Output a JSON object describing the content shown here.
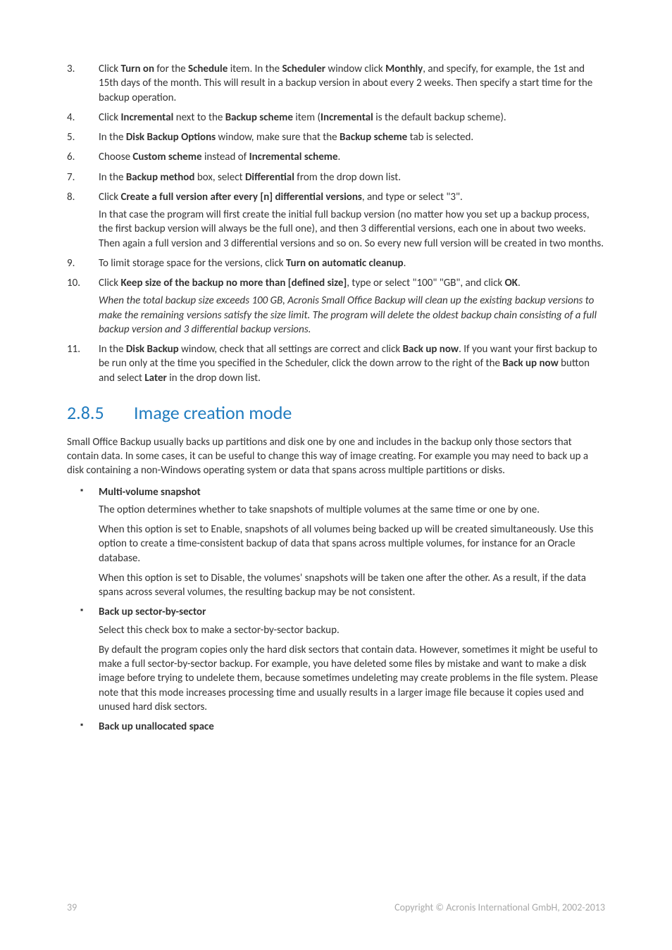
{
  "list": {
    "i3": {
      "num": "3.",
      "html": "Click <b>Turn on</b> for the <b>Schedule</b> item. In the <b>Scheduler</b> window click <b>Monthly</b>, and specify, for example, the 1st and 15th days of the month. This will result in a backup version in about every 2 weeks. Then specify a start time for the backup operation."
    },
    "i4": {
      "num": "4.",
      "html": "Click <b>Incremental</b> next to the <b>Backup scheme</b> item (<b>Incremental</b> is the default backup scheme)."
    },
    "i5": {
      "num": "5.",
      "html": "In the <b>Disk Backup Options</b> window, make sure that the <b>Backup scheme</b> tab is selected."
    },
    "i6": {
      "num": "6.",
      "html": "Choose <b>Custom scheme</b> instead of <b>Incremental scheme</b>."
    },
    "i7": {
      "num": "7.",
      "html": "In the <b>Backup method</b> box, select <b>Differential</b> from the drop down list."
    },
    "i8": {
      "num": "8.",
      "html": "Click <b>Create a full version after every [n] differential versions</b>, and type or select \"3\".",
      "sub": "In that case the program will first create the initial full backup version (no matter how you set up a backup process, the first backup version will always be the full one), and then 3 differential versions, each one in about two weeks. Then again a full version and 3 differential versions and so on. So every new full version will be created in two months."
    },
    "i9": {
      "num": "9.",
      "html": "To limit storage space for the versions, click <b>Turn on automatic cleanup</b>."
    },
    "i10": {
      "num": "10.",
      "html": "Click <b>Keep size of the backup no more than [defined size]</b>, type or select \"100\" \"GB\", and click <b>OK</b>.",
      "note": "When the total backup size exceeds 100 GB, Acronis Small Office Backup will clean up the existing backup versions to make the remaining versions satisfy the size limit. The program will delete the oldest backup chain consisting of a full backup version and 3 differential backup versions."
    },
    "i11": {
      "num": "11.",
      "html": "In the <b>Disk Backup</b> window, check that all settings are correct and click <b>Back up now</b>. If you want your first backup to be run only at the time you specified in the Scheduler, click the down arrow to the right of the <b>Back up now</b> button and select <b>Later</b> in the drop down list."
    }
  },
  "section": {
    "num": "2.8.5",
    "title": "Image creation mode"
  },
  "intro": "Small Office Backup usually backs up partitions and disk one by one and includes in the backup only those sectors that contain data. In some cases, it can be useful to change this way of image creating. For example you may need to back up a disk containing a non-Windows operating system or data that spans across multiple partitions or disks.",
  "bullets": {
    "b1": {
      "title": "Multi-volume snapshot",
      "p1": "The option determines whether to take snapshots of multiple volumes at the same time or one by one.",
      "p2": "When this option is set to Enable, snapshots of all volumes being backed up will be created simultaneously. Use this option to create a time-consistent backup of data that spans across multiple volumes, for instance for an Oracle database.",
      "p3": "When this option is set to Disable, the volumes' snapshots will be taken one after the other. As a result, if the data spans across several volumes, the resulting backup may be not consistent."
    },
    "b2": {
      "title": "Back up sector-by-sector",
      "p1": "Select this check box to make a sector-by-sector backup.",
      "p2": "By default the program copies only the hard disk sectors that contain data. However, sometimes it might be useful to make a full sector-by-sector backup. For example, you have deleted some files by mistake and want to make a disk image before trying to undelete them, because sometimes undeleting may create problems in the file system. Please note that this mode increases processing time and usually results in a larger image file because it copies used and unused hard disk sectors."
    },
    "b3": {
      "title": "Back up unallocated space"
    }
  },
  "footer": {
    "page": "39",
    "copyright": "Copyright © Acronis International GmbH, 2002-2013"
  }
}
